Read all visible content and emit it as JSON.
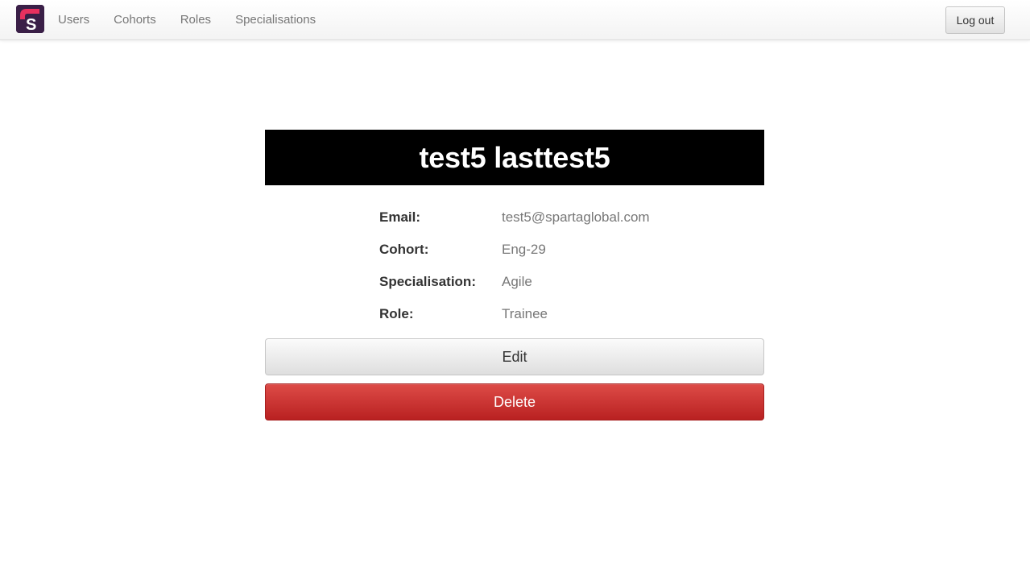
{
  "nav": {
    "logo_letter": "S",
    "links": [
      {
        "label": "Users"
      },
      {
        "label": "Cohorts"
      },
      {
        "label": "Roles"
      },
      {
        "label": "Specialisations"
      }
    ],
    "logout_label": "Log out"
  },
  "profile": {
    "name": "test5 lasttest5",
    "fields": [
      {
        "label": "Email:",
        "value": "test5@spartaglobal.com"
      },
      {
        "label": "Cohort:",
        "value": "Eng-29"
      },
      {
        "label": "Specialisation:",
        "value": "Agile"
      },
      {
        "label": "Role:",
        "value": "Trainee"
      }
    ]
  },
  "actions": {
    "edit_label": "Edit",
    "delete_label": "Delete"
  },
  "colors": {
    "brand_purple": "#3a1f47",
    "brand_pink": "#e8305e",
    "danger": "#c9302c",
    "title_bg": "#000000"
  },
  "icons": {
    "logo": "sparta-logo-icon"
  }
}
